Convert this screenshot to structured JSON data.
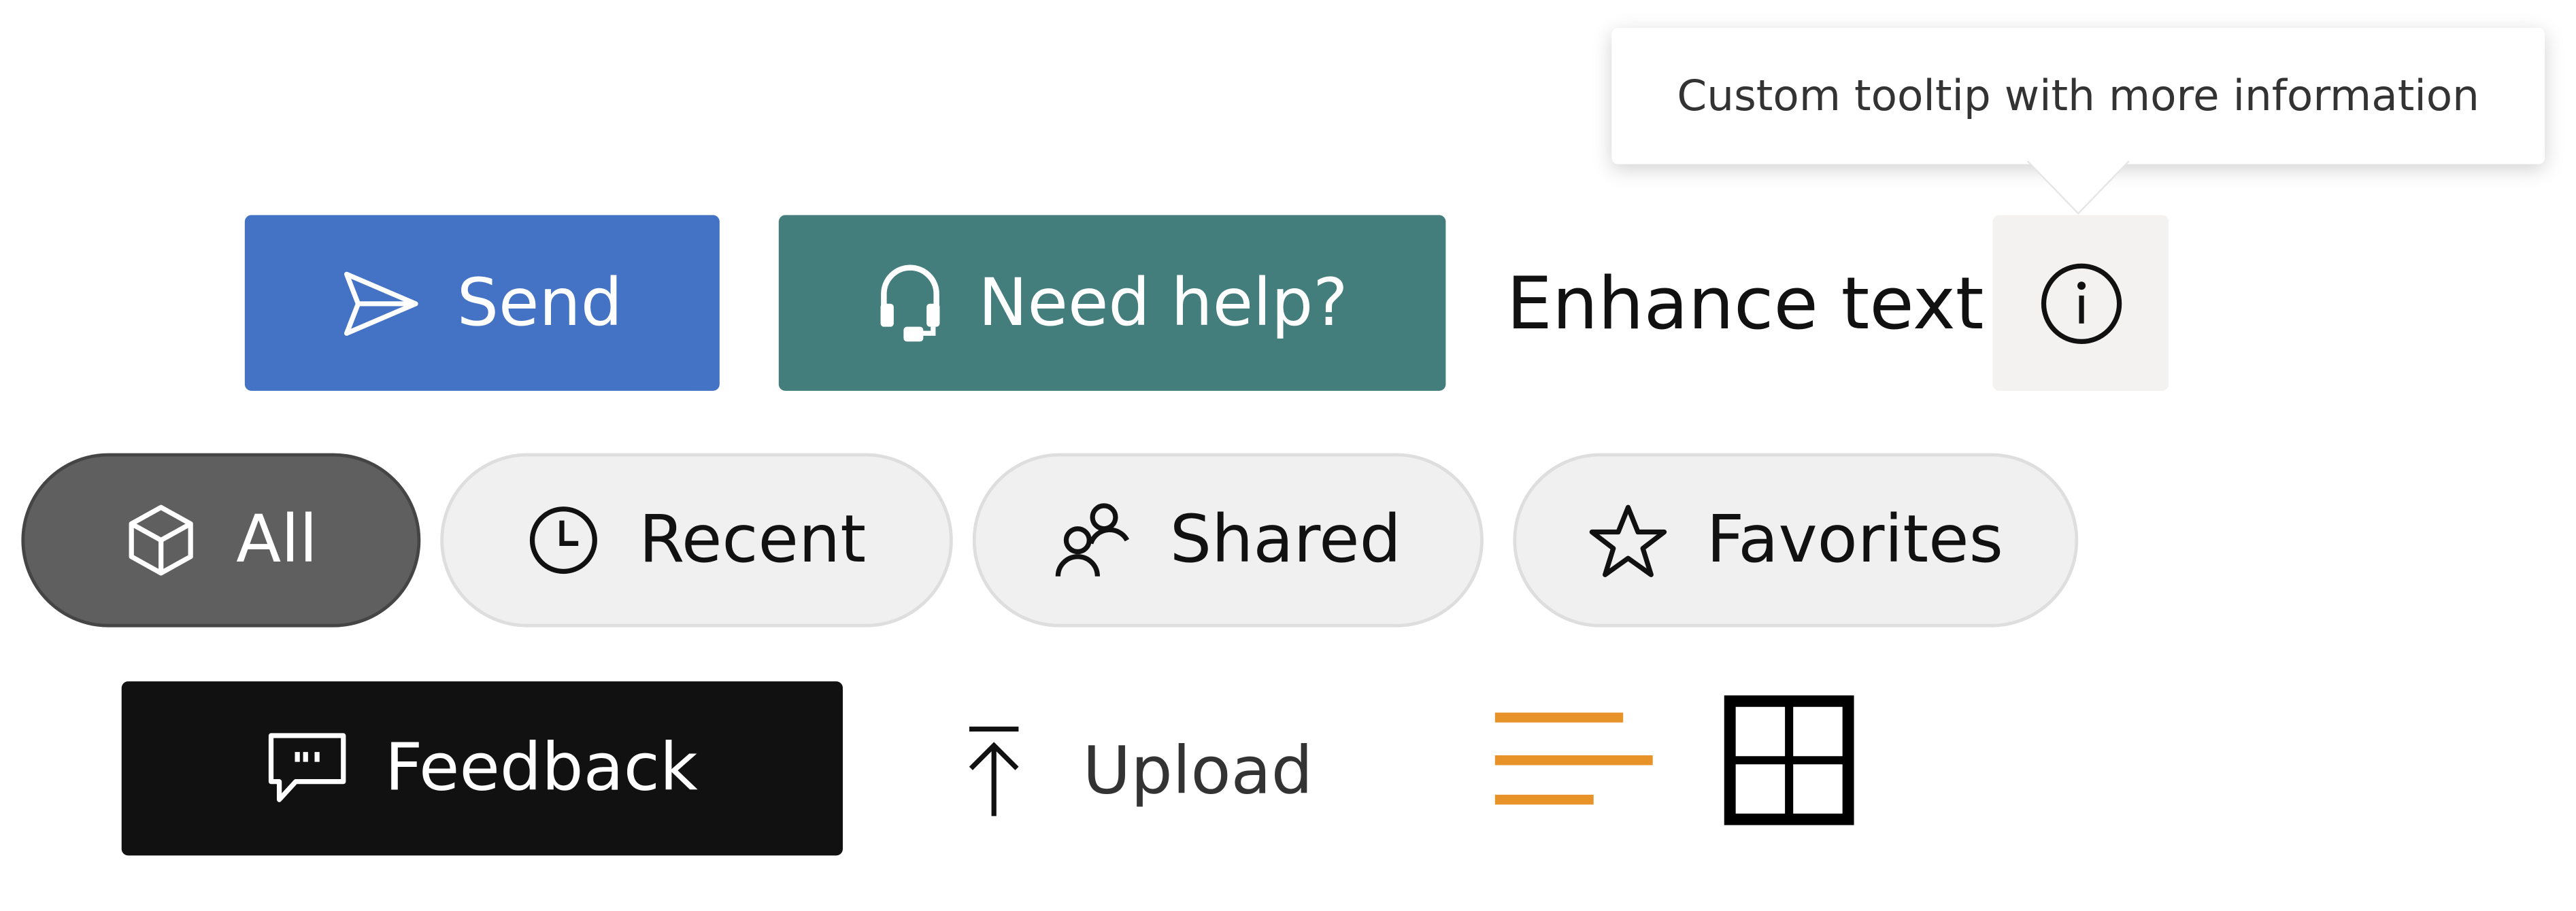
{
  "tooltip": {
    "text": "Custom tooltip with more information"
  },
  "buttons": {
    "send": {
      "label": "Send",
      "icon": "send-icon",
      "color": "#4472C4"
    },
    "help": {
      "label": "Need help?",
      "icon": "headset-icon",
      "color": "#437E7D"
    },
    "enhance": {
      "label": "Enhance text"
    },
    "info": {
      "icon": "info-icon",
      "color": "#F3F2F1"
    },
    "feedback": {
      "label": "Feedback",
      "icon": "feedback-icon",
      "color": "#111111"
    },
    "upload": {
      "label": "Upload",
      "icon": "upload-icon"
    }
  },
  "filters": [
    {
      "label": "All",
      "icon": "cube-icon",
      "selected": true
    },
    {
      "label": "Recent",
      "icon": "clock-icon",
      "selected": false
    },
    {
      "label": "Shared",
      "icon": "people-icon",
      "selected": false
    },
    {
      "label": "Favorites",
      "icon": "star-icon",
      "selected": false
    }
  ],
  "view_toggles": {
    "list_icon": "text-align-left-icon",
    "list_color": "#E8922A",
    "grid_icon": "grid-icon"
  }
}
